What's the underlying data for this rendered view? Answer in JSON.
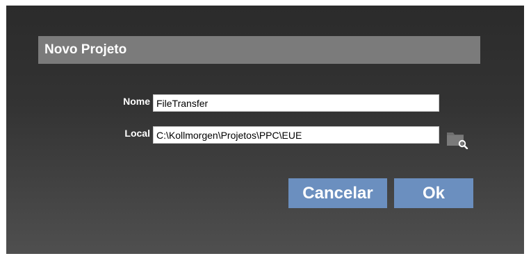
{
  "dialog": {
    "title": "Novo Projeto"
  },
  "form": {
    "name_label": "Nome",
    "name_value": "FileTransfer",
    "location_label": "Local",
    "location_value": "C:\\Kollmorgen\\Projetos\\PPC\\EUE"
  },
  "icons": {
    "browse": "folder-search-icon"
  },
  "buttons": {
    "cancel_label": "Cancelar",
    "ok_label": "Ok"
  },
  "colors": {
    "title_bar": "#7b7b7b",
    "button": "#6b8fbf",
    "background_top": "#2b2b2b",
    "background_bottom": "#4f4f4f"
  }
}
